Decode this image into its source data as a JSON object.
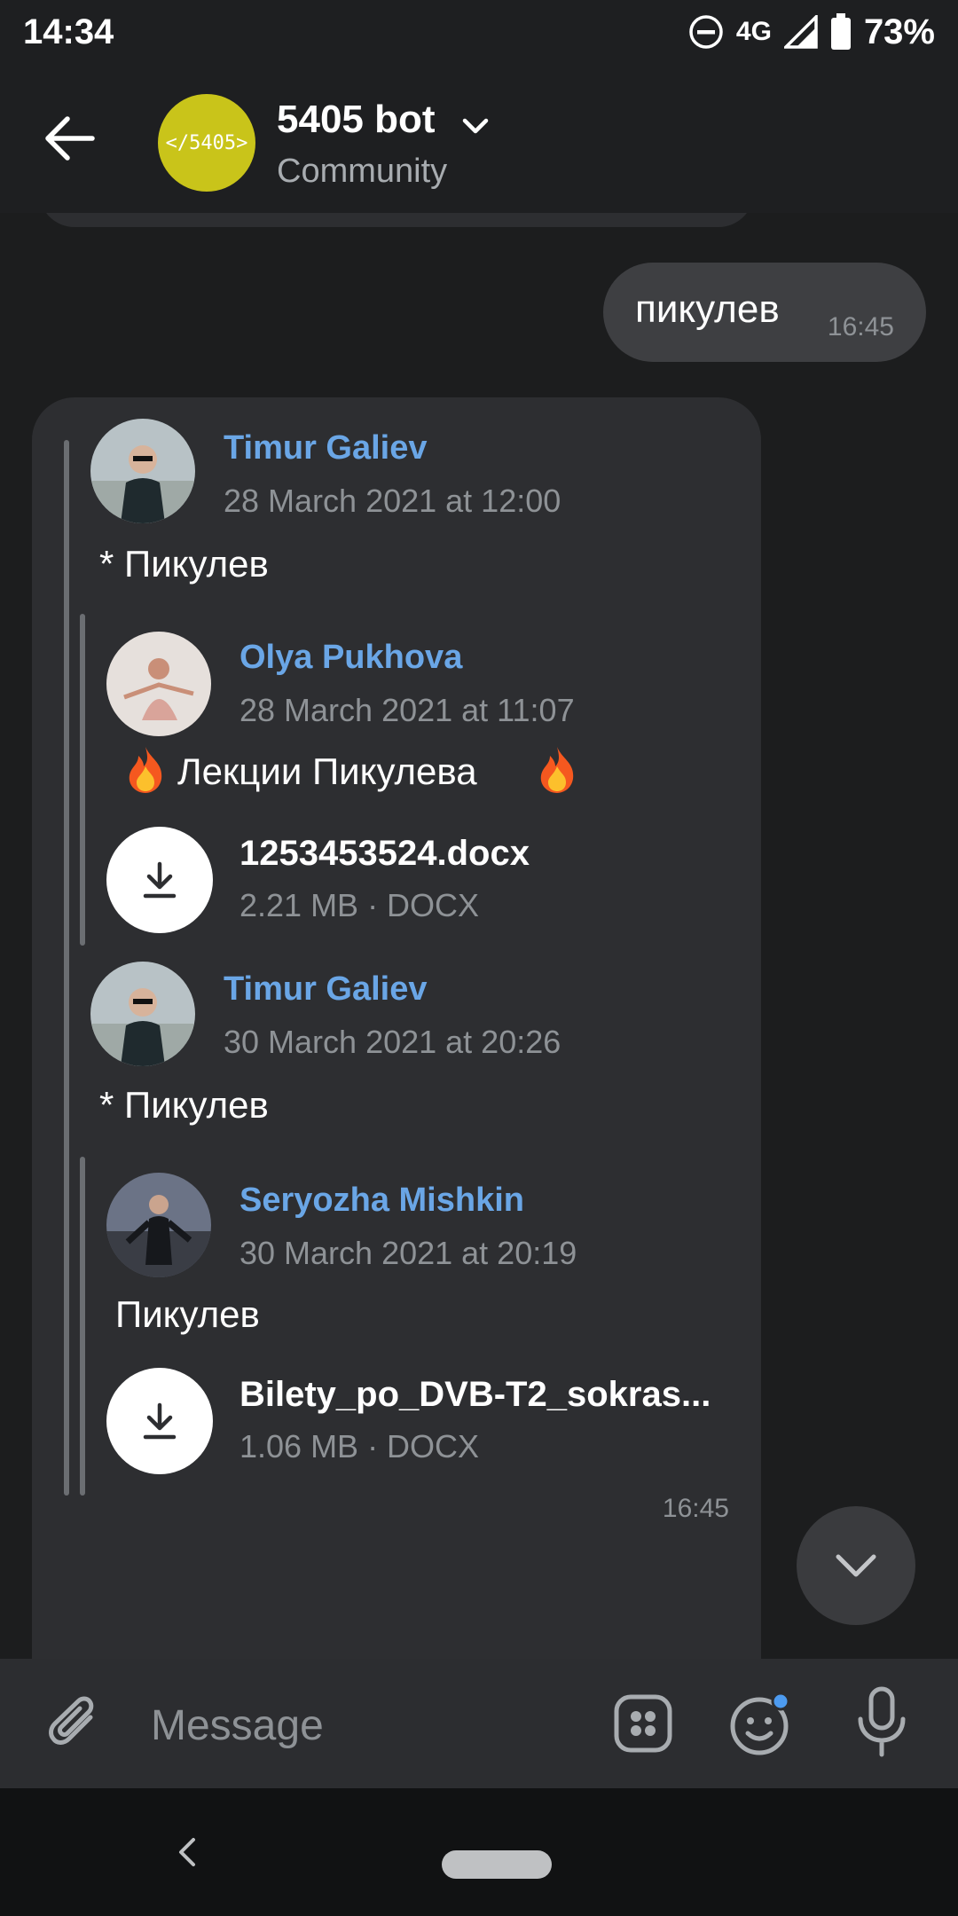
{
  "status_bar": {
    "time": "14:34",
    "network": "4G",
    "battery": "73%"
  },
  "header": {
    "title": "5405 bot",
    "subtitle": "Community",
    "avatar_text": "</5405>",
    "avatar_color": "#c9c41a"
  },
  "messages": {
    "outgoing": {
      "text": "пикулев",
      "time": "16:45"
    },
    "incoming": {
      "time": "16:45",
      "posts": [
        {
          "author": "Timur Galiev",
          "date": "28 March 2021 at 12:00",
          "text": "* Пикулев",
          "quoted": {
            "author": "Olya Pukhova",
            "date": "28 March 2021 at 11:07",
            "text": "Лекции Пикулева",
            "file": {
              "name": "1253453524.docx",
              "meta": "2.21 MB · DOCX"
            }
          }
        },
        {
          "author": "Timur Galiev",
          "date": "30 March 2021 at 20:26",
          "text": "* Пикулев",
          "quoted": {
            "author": "Seryozha Mishkin",
            "date": "30 March 2021 at 20:19",
            "text": "Пикулев",
            "file": {
              "name": "Bilety_po_DVB-T2_sokras...",
              "meta": "1.06 MB · DOCX"
            }
          }
        }
      ]
    }
  },
  "input": {
    "placeholder": "Message"
  },
  "colors": {
    "accent": "#6aa6e6",
    "bubble_in": "#2d2e31",
    "bubble_out": "#3e3f42",
    "unread_dot": "#4d9bf0"
  }
}
